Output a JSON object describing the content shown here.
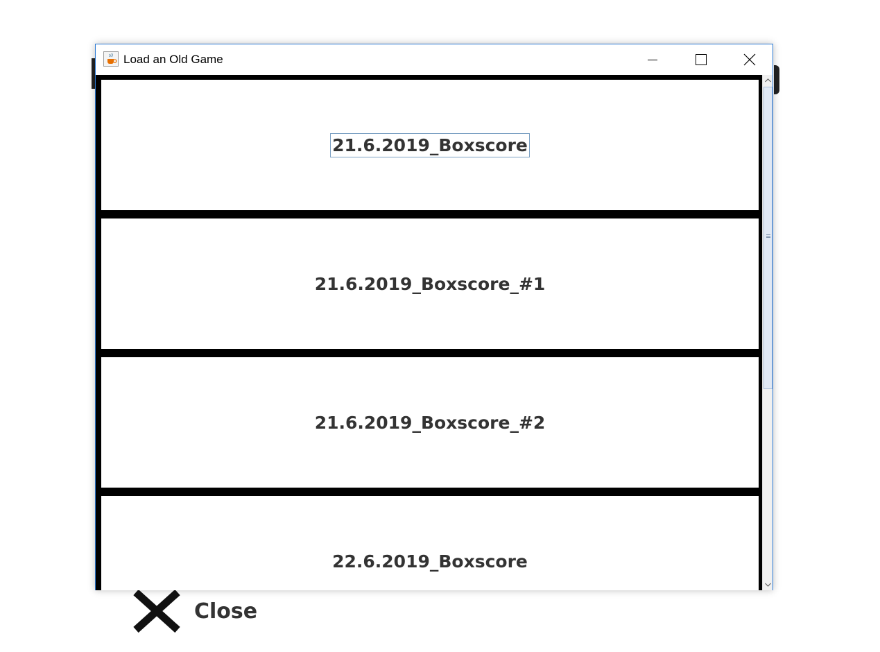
{
  "window": {
    "title": "Load an Old Game",
    "icon": "java-cup-icon",
    "controls": [
      "minimize-icon",
      "maximize-icon",
      "close-icon"
    ]
  },
  "games": [
    {
      "label": "21.6.2019_Boxscore",
      "focused": true
    },
    {
      "label": "21.6.2019_Boxscore_#1",
      "focused": false
    },
    {
      "label": "21.6.2019_Boxscore_#2",
      "focused": false
    },
    {
      "label": "22.6.2019_Boxscore",
      "focused": false
    }
  ],
  "background": {
    "close_label": "Close",
    "close_icon": "x-icon"
  },
  "colors": {
    "separator": "#000000",
    "text": "#333333",
    "window_border": "#2b79d4"
  }
}
